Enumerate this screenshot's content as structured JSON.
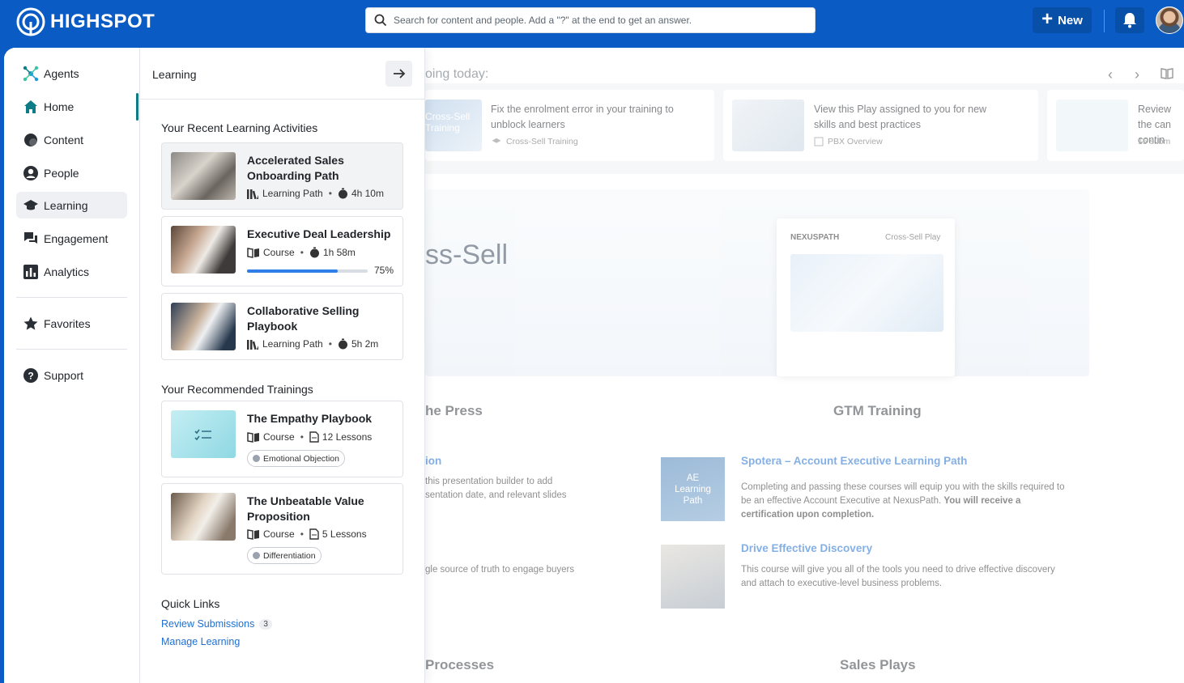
{
  "header": {
    "logo_text": "HIGHSPOT",
    "search_placeholder": "Search for content and people. Add a \"?\" at the end to get an answer.",
    "new_label": "New",
    "accent": "#0a5bc4"
  },
  "sidebar": {
    "items": [
      {
        "label": "Agents",
        "icon": "agents-icon"
      },
      {
        "label": "Home",
        "icon": "home-icon"
      },
      {
        "label": "Content",
        "icon": "content-icon"
      },
      {
        "label": "People",
        "icon": "person-icon"
      },
      {
        "label": "Learning",
        "icon": "graduation-cap-icon",
        "active": true
      },
      {
        "label": "Engagement",
        "icon": "chat-icon"
      },
      {
        "label": "Analytics",
        "icon": "bar-chart-icon"
      },
      {
        "label": "Favorites",
        "icon": "star-icon"
      },
      {
        "label": "Support",
        "icon": "help-icon"
      }
    ]
  },
  "panel": {
    "title": "Learning",
    "recent_title": "Your Recent Learning Activities",
    "recent": [
      {
        "title": "Accelerated Sales Onboarding Path",
        "type": "Learning Path",
        "duration": "4h 10m"
      },
      {
        "title": "Executive Deal Leadership",
        "type": "Course",
        "duration": "1h 58m",
        "progress": 75,
        "progress_label": "75%"
      },
      {
        "title": "Collaborative Selling Playbook",
        "type": "Learning Path",
        "duration": "5h 2m"
      }
    ],
    "recommended_title": "Your Recommended Trainings",
    "recommended": [
      {
        "title": "The Empathy Playbook",
        "type": "Course",
        "lessons": "12 Lessons",
        "tag": "Emotional Objection"
      },
      {
        "title": "The Unbeatable Value Proposition",
        "type": "Course",
        "lessons": "5 Lessons",
        "tag": "Differentiation"
      }
    ],
    "quick_links_title": "Quick Links",
    "quick_links": [
      {
        "label": "Review Submissions",
        "count": "3"
      },
      {
        "label": "Manage Learning"
      }
    ]
  },
  "background": {
    "going_today": "oing today:",
    "rec_cards": [
      {
        "thumb_text": "Cross-Sell Training",
        "text": "Fix the enrolment error in your training to unblock learners",
        "sub": "Cross-Sell Training"
      },
      {
        "text": "View this Play assigned to you for new skills and best practices",
        "sub": "PBX Overview"
      },
      {
        "text": "Review the can contin",
        "sub": "15 subm"
      }
    ],
    "hero_text": "ss-Sell",
    "hero_brand": "NEXUSPATH",
    "hero_doc_label": "Cross-Sell Play",
    "section_press": "he Press",
    "press_link": "ion",
    "press_text1": "this presentation builder to add\nsentation date, and relevant slides",
    "press_text2": "gle source of truth to engage buyers",
    "section_gtm": "GTM Training",
    "ae_box": "AE\nLearning\nPath",
    "gtm_link1": "Spotera – Account Executive Learning Path",
    "gtm_text1": "Completing and passing these courses will equip you with the skills required to be an effective Account Executive at NexusPath.",
    "gtm_text1_bold": "You will receive a certification upon completion.",
    "gtm_link2": "Drive Effective Discovery",
    "gtm_text2": "This course will give you all of the tools you need to drive effective discovery and attach to executive-level business problems.",
    "section_processes": "Processes",
    "section_sales_plays": "Sales Plays"
  }
}
